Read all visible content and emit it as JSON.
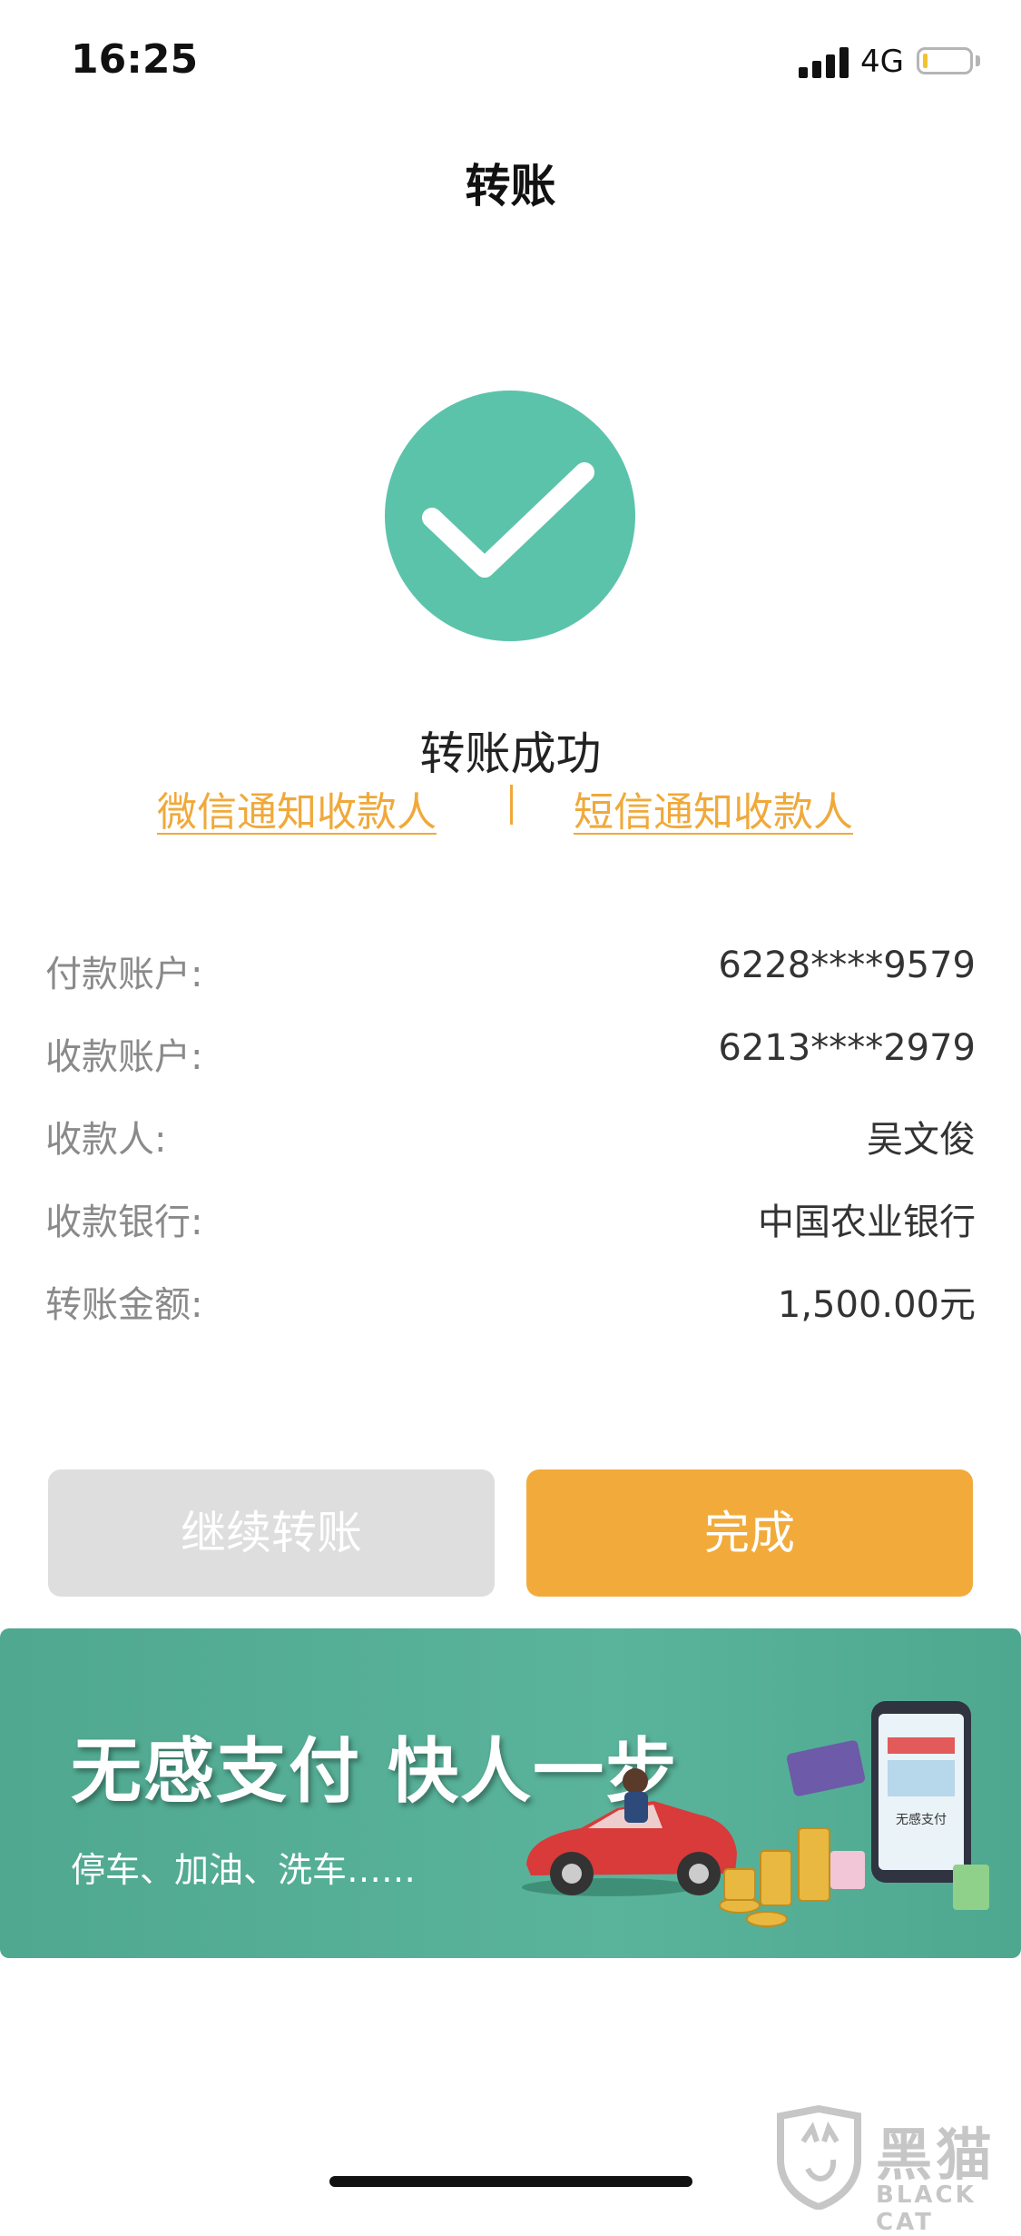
{
  "status_bar": {
    "time": "16:25",
    "network": "4G"
  },
  "nav": {
    "title": "转账"
  },
  "result": {
    "status_text": "转账成功",
    "wechat_notify": "微信通知收款人",
    "sms_notify": "短信通知收款人"
  },
  "details": [
    {
      "label": "付款账户:",
      "value": "6228****9579"
    },
    {
      "label": "收款账户:",
      "value": "6213****2979"
    },
    {
      "label": "收款人:",
      "value": "吴文俊"
    },
    {
      "label": "收款银行:",
      "value": "中国农业银行"
    },
    {
      "label": "转账金额:",
      "value": "1,500.00元"
    }
  ],
  "actions": {
    "continue_label": "继续转账",
    "done_label": "完成"
  },
  "banner": {
    "title": "无感支付 快人一步",
    "subtitle": "停车、加油、洗车……",
    "illustration_text": "无感支付"
  },
  "watermark": {
    "text": "黑猫",
    "sub": "BLACK CAT"
  },
  "colors": {
    "success_green": "#5cc3ab",
    "link_orange": "#f0a93a",
    "primary_button": "#f2ab3b",
    "secondary_button": "#dedede",
    "banner_green": "#53ad95"
  }
}
